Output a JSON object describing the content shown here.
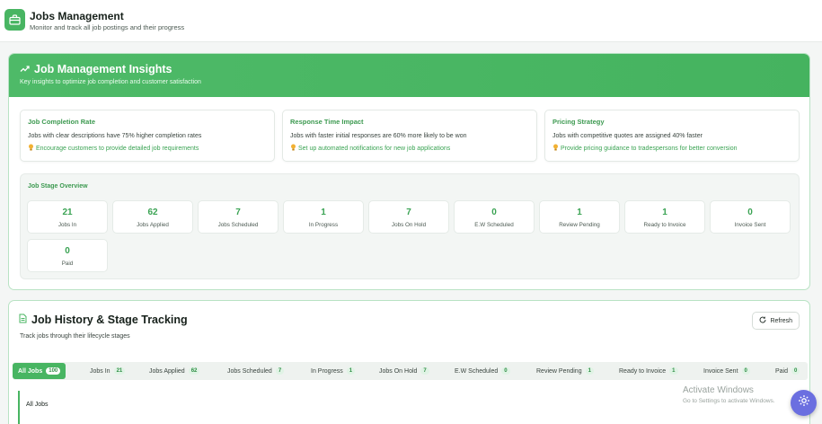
{
  "header": {
    "title": "Jobs Management",
    "subtitle": "Monitor and track all job postings and their progress"
  },
  "insights": {
    "title": "Job Management Insights",
    "subtitle": "Key insights to optimize job completion and customer satisfaction",
    "cards": [
      {
        "title": "Job Completion Rate",
        "text": "Jobs with clear descriptions have 75% higher completion rates",
        "tip": "Encourage customers to provide detailed job requirements"
      },
      {
        "title": "Response Time Impact",
        "text": "Jobs with faster initial responses are 60% more likely to be won",
        "tip": "Set up automated notifications for new job applications"
      },
      {
        "title": "Pricing Strategy",
        "text": "Jobs with competitive quotes are assigned 40% faster",
        "tip": "Provide pricing guidance to tradespersons for better conversion"
      }
    ],
    "stage_title": "Job Stage Overview",
    "stages": [
      {
        "value": "21",
        "label": "Jobs In"
      },
      {
        "value": "62",
        "label": "Jobs Applied"
      },
      {
        "value": "7",
        "label": "Jobs Scheduled"
      },
      {
        "value": "1",
        "label": "In Progress"
      },
      {
        "value": "7",
        "label": "Jobs On Hold"
      },
      {
        "value": "0",
        "label": "E.W Scheduled"
      },
      {
        "value": "1",
        "label": "Review Pending"
      },
      {
        "value": "1",
        "label": "Ready to Invoice"
      },
      {
        "value": "0",
        "label": "Invoice Sent"
      },
      {
        "value": "0",
        "label": "Paid"
      }
    ]
  },
  "history": {
    "title": "Job History & Stage Tracking",
    "subtitle": "Track jobs through their lifecycle stages",
    "refresh_label": "Refresh",
    "tabs": [
      {
        "label": "All Jobs",
        "count": "100"
      },
      {
        "label": "Jobs In",
        "count": "21"
      },
      {
        "label": "Jobs Applied",
        "count": "62"
      },
      {
        "label": "Jobs Scheduled",
        "count": "7"
      },
      {
        "label": "In Progress",
        "count": "1"
      },
      {
        "label": "Jobs On Hold",
        "count": "7"
      },
      {
        "label": "E.W Scheduled",
        "count": "0"
      },
      {
        "label": "Review Pending",
        "count": "1"
      },
      {
        "label": "Ready to Invoice",
        "count": "1"
      },
      {
        "label": "Invoice Sent",
        "count": "0"
      },
      {
        "label": "Paid",
        "count": "0"
      }
    ],
    "panel_label": "All Jobs"
  },
  "watermark": {
    "line1": "Activate Windows",
    "line2": "Go to Settings to activate Windows."
  },
  "colors": {
    "accent": "#48b562",
    "fab": "#6b6fe0"
  }
}
